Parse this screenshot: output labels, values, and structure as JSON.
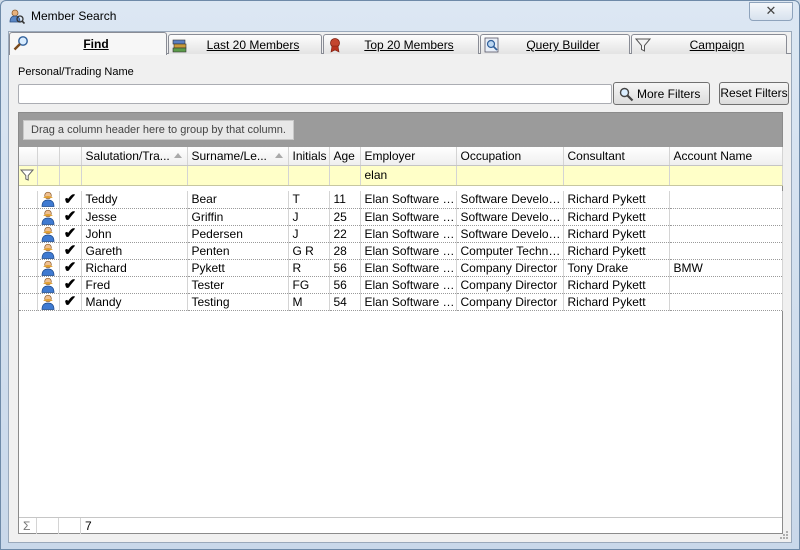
{
  "window": {
    "title": "Member Search",
    "close_label": "✕"
  },
  "tabs": [
    {
      "label": "Find",
      "icon": "search-icon",
      "active": true
    },
    {
      "label": "Last 20 Members",
      "icon": "books-icon",
      "active": false
    },
    {
      "label": "Top 20 Members",
      "icon": "award-icon",
      "active": false
    },
    {
      "label": "Query Builder",
      "icon": "query-icon",
      "active": false
    },
    {
      "label": "Campaign",
      "icon": "funnel-icon",
      "active": false
    }
  ],
  "search": {
    "label": "Personal/Trading Name",
    "value": "",
    "placeholder": ""
  },
  "buttons": {
    "more_filters": "More Filters",
    "reset_filters": "Reset Filters"
  },
  "grid": {
    "group_hint": "Drag a column header here to group by that column.",
    "columns": [
      "Salutation/Tra...",
      "Surname/Le...",
      "Initials",
      "Age",
      "Employer",
      "Occupation",
      "Consultant",
      "Account Name"
    ],
    "filter": {
      "employer": "elan"
    },
    "rows": [
      [
        "Teddy",
        "Bear",
        "T",
        "11",
        "Elan Software S...",
        "Software Developer",
        "Richard Pykett",
        ""
      ],
      [
        "Jesse",
        "Griffin",
        "J",
        "25",
        "Elan Software S...",
        "Software Developer",
        "Richard Pykett",
        ""
      ],
      [
        "John",
        "Pedersen",
        "J",
        "22",
        "Elan Software S...",
        "Software Developer",
        "Richard Pykett",
        ""
      ],
      [
        "Gareth",
        "Penten",
        "G R",
        "28",
        "Elan Software S...",
        "Computer Technic...",
        "Richard Pykett",
        ""
      ],
      [
        "Richard",
        "Pykett",
        "R",
        "56",
        "Elan Software S...",
        "Company Director",
        "Tony Drake",
        "BMW"
      ],
      [
        "Fred",
        "Tester",
        "FG",
        "56",
        "Elan Software S...",
        "Company Director",
        "Richard Pykett",
        ""
      ],
      [
        "Mandy",
        "Testing",
        "M",
        "54",
        "Elan Software S...",
        "Company Director",
        "Richard Pykett",
        ""
      ]
    ],
    "summary": {
      "symbol": "Σ",
      "count": "7"
    }
  }
}
